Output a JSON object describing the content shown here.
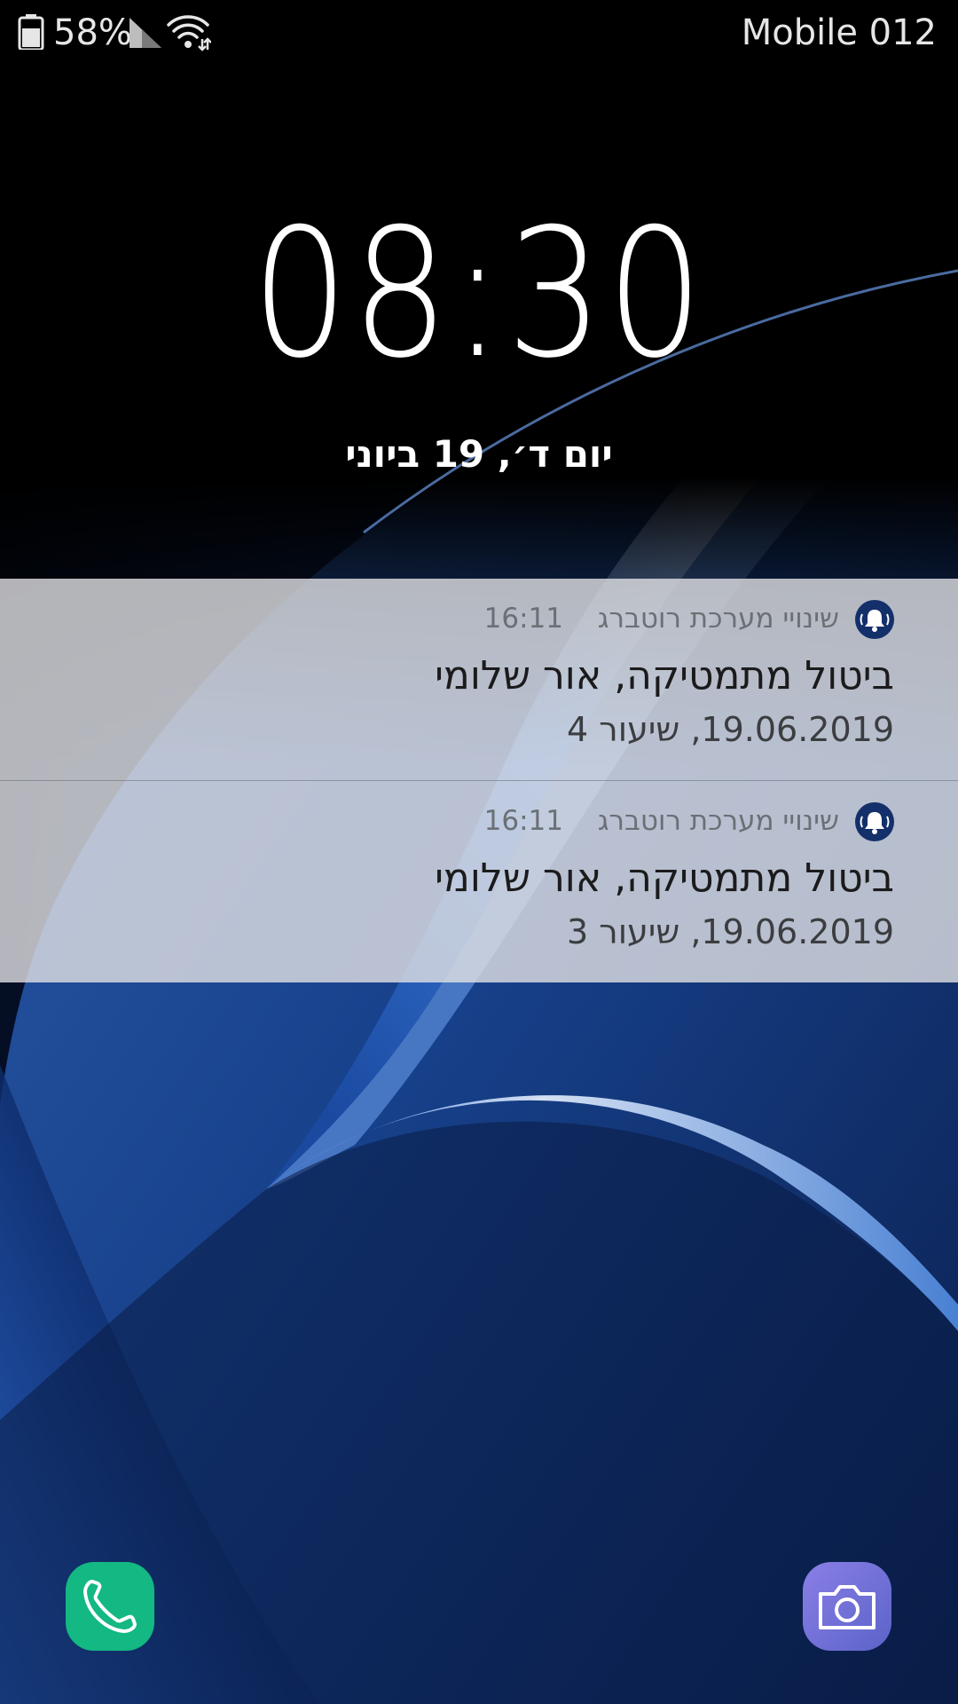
{
  "status_bar": {
    "battery_percent": "58%",
    "carrier": "Mobile 012",
    "icons": [
      "battery-icon",
      "signal-icon",
      "wifi-icon"
    ]
  },
  "lockscreen": {
    "time": "08:30",
    "date": "יום ד׳, 19 ביוני"
  },
  "notifications": [
    {
      "app_name": "שינויי מערכת רוטברג",
      "time": "16:11",
      "title": "ביטול מתמטיקה, אור שלומי",
      "body": "19.06.2019, שיעור 4",
      "icon": "bell-icon"
    },
    {
      "app_name": "שינויי מערכת רוטברג",
      "time": "16:11",
      "title": "ביטול מתמטיקה, אור שלומי",
      "body": "19.06.2019, שיעור 3",
      "icon": "bell-icon"
    }
  ],
  "shortcuts": {
    "left": "phone-icon",
    "right": "camera-icon"
  },
  "colors": {
    "phone_shortcut": "#13b883",
    "camera_shortcut": "#6f6fd8",
    "notification_icon": "#14306a",
    "notification_background": "#e1e1e4"
  }
}
